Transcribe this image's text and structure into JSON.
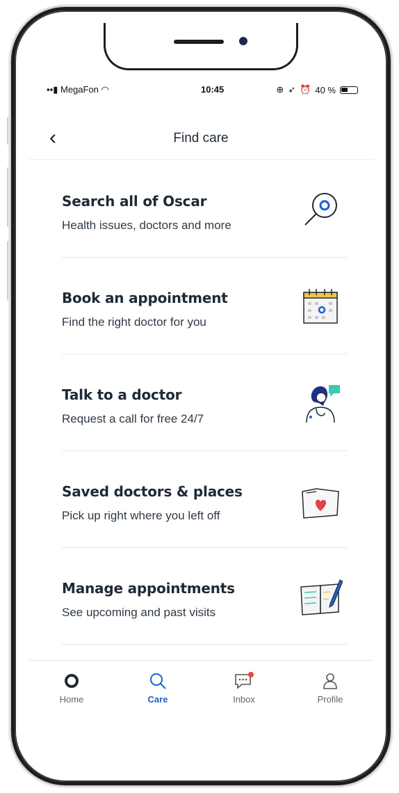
{
  "status_bar": {
    "carrier": "MegaFon",
    "time": "10:45",
    "battery": "40 %"
  },
  "header": {
    "title": "Find care"
  },
  "items": [
    {
      "title": "Search all of Oscar",
      "subtitle": "Health issues, doctors and more",
      "icon": "search-magnifier-icon"
    },
    {
      "title": "Book an appointment",
      "subtitle": "Find the right doctor for you",
      "icon": "calendar-icon"
    },
    {
      "title": "Talk to a doctor",
      "subtitle": "Request a call for free 24/7",
      "icon": "doctor-chat-icon"
    },
    {
      "title": "Saved doctors & places",
      "subtitle": "Pick up right where you left off",
      "icon": "folder-heart-icon"
    },
    {
      "title": "Manage appointments",
      "subtitle": "See upcoming and past visits",
      "icon": "notebook-pen-icon"
    }
  ],
  "tabs": [
    {
      "label": "Home",
      "icon": "home-circle-icon"
    },
    {
      "label": "Care",
      "icon": "search-icon",
      "active": true
    },
    {
      "label": "Inbox",
      "icon": "chat-bubble-icon",
      "badge": true
    },
    {
      "label": "Profile",
      "icon": "person-icon"
    }
  ],
  "colors": {
    "accent": "#1f5fd0",
    "badge": "#f0443a",
    "text": "#1f2a36",
    "teal": "#3ec9b0"
  }
}
